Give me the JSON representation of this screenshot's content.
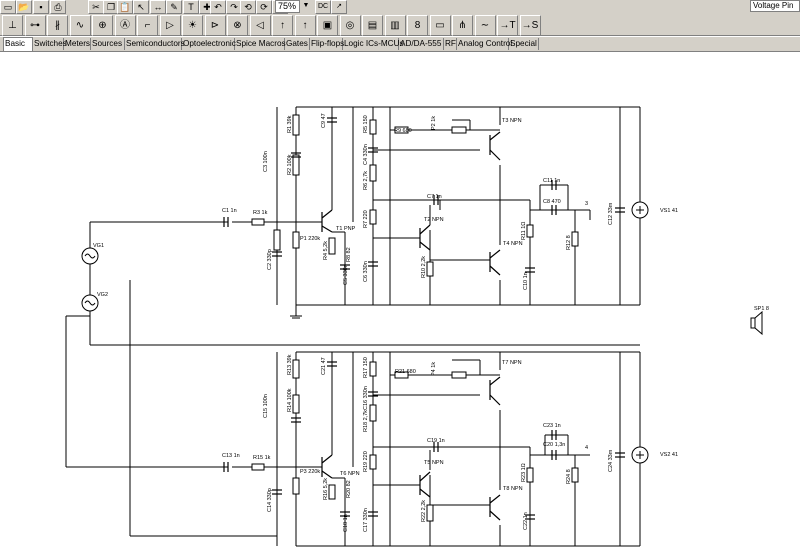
{
  "toolbar": {
    "zoom": "75%",
    "component_select": "Voltage Pin",
    "buttons": [
      {
        "icon": "new-icon",
        "glyph": "▭"
      },
      {
        "icon": "open-icon",
        "glyph": "📂"
      },
      {
        "icon": "save-icon",
        "glyph": "▪"
      },
      {
        "icon": "print-icon",
        "glyph": "⎙"
      },
      {
        "icon": "cut-icon",
        "glyph": "✂"
      },
      {
        "icon": "copy-icon",
        "glyph": "❐"
      },
      {
        "icon": "paste-icon",
        "glyph": "📋"
      },
      {
        "icon": "pointer-icon",
        "glyph": "↖"
      },
      {
        "icon": "wire-icon",
        "glyph": "↔"
      },
      {
        "icon": "pencil-icon",
        "glyph": "✎"
      },
      {
        "icon": "text-icon",
        "glyph": "T"
      },
      {
        "icon": "dimension-icon",
        "glyph": "✚"
      },
      {
        "icon": "undo-icon",
        "glyph": "↶"
      },
      {
        "icon": "redo-icon",
        "glyph": "↷"
      },
      {
        "icon": "rotate-left-icon",
        "glyph": "⟲"
      },
      {
        "icon": "rotate-right-icon",
        "glyph": "⟳"
      },
      {
        "icon": "grid-icon",
        "glyph": "⋮"
      }
    ],
    "right_buttons": [
      {
        "icon": "dc-analysis-icon",
        "glyph": "DC"
      },
      {
        "icon": "probe-icon",
        "glyph": "↗"
      }
    ]
  },
  "parts": [
    {
      "icon": "ground-part-icon",
      "glyph": "⊥"
    },
    {
      "icon": "resistor-part-icon",
      "glyph": "⊶"
    },
    {
      "icon": "capacitor-part-icon",
      "glyph": "∦"
    },
    {
      "icon": "inductor-part-icon",
      "glyph": "∿"
    },
    {
      "icon": "voltage-source-part-icon",
      "glyph": "⊕"
    },
    {
      "icon": "ammeter-part-icon",
      "glyph": "Ⓐ"
    },
    {
      "icon": "switch-part-icon",
      "glyph": "⌐"
    },
    {
      "icon": "diode-part-icon",
      "glyph": "▷"
    },
    {
      "icon": "led-part-icon",
      "glyph": "☀"
    },
    {
      "icon": "transistor-part-icon",
      "glyph": "⊳"
    },
    {
      "icon": "lamp-part-icon",
      "glyph": "⊗"
    },
    {
      "icon": "speaker-part-icon",
      "glyph": "◁"
    },
    {
      "icon": "probe-part-icon",
      "glyph": "↑"
    },
    {
      "icon": "voltmeter-part-icon",
      "glyph": "↑"
    },
    {
      "icon": "oscilloscope-part-icon",
      "glyph": "▣"
    },
    {
      "icon": "signal-analyzer-part-icon",
      "glyph": "◎"
    },
    {
      "icon": "function-generator-part-icon",
      "glyph": "▤"
    },
    {
      "icon": "logic-display-part-icon",
      "glyph": "▥"
    },
    {
      "icon": "seven-segment-part-icon",
      "glyph": "8"
    },
    {
      "icon": "monitor-part-icon",
      "glyph": "▭"
    },
    {
      "icon": "traffic-light-part-icon",
      "glyph": "⋔"
    },
    {
      "icon": "ac-source-part-icon",
      "glyph": "∼"
    },
    {
      "icon": "input-pin-part-icon",
      "glyph": "→T"
    },
    {
      "icon": "output-pin-part-icon",
      "glyph": "→S"
    }
  ],
  "tabs": [
    "Basic",
    "Switches",
    "Meters",
    "Sources",
    "Semiconductors",
    "Optoelectronic",
    "Spice Macros",
    "Gates",
    "Flip-flops",
    "Logic ICs-MCUs",
    "AD/DA-555",
    "RF",
    "Analog Control",
    "Special"
  ],
  "schematic": {
    "channel1": {
      "C1": "C1 1n",
      "R3": "R3 1k",
      "P1": "P1 220k",
      "R4": "R4 5,2k",
      "C2": "C2 330p",
      "C3": "C3 100n",
      "R1": "R1 39k",
      "R2": "R2 100k",
      "C9": "C9 47",
      "C4": "C4 330n",
      "R5": "R5 150",
      "R6": "R6 2,7k",
      "R7": "R7 220",
      "R8": "R8 82",
      "C5": "C5 330n",
      "C6": "C6 330n",
      "R9": "R9 680",
      "P2": "P2 1k",
      "T1": "T1 PNP",
      "T2": "T2 NPN",
      "T3": "T3 NPN",
      "T4": "T4 NPN",
      "R10": "R10 2,2k",
      "C7": "C7 1n",
      "C8": "C8 470",
      "C11": "C11 1n",
      "R11": "R11 1Ω",
      "R12": "R12 8",
      "C10": "C10 1n",
      "C12": "C12 33m",
      "VG1": "VG1",
      "VG2": "VG2",
      "VS1": "VS1 41",
      "node": "3"
    },
    "channel2": {
      "C13": "C13 1n",
      "R15": "R15 1k",
      "P3": "P3 220k",
      "R16": "R16 5,2k",
      "C14": "C14 330p",
      "C15": "C15 100n",
      "R13": "R13 39k",
      "R14": "R14 100k",
      "C21": "C21 47",
      "C16": "C16 330n",
      "R17": "R17 150",
      "R18": "R18 2,7k",
      "R19": "R19 220",
      "R20": "R20 82",
      "C18": "C18 1n",
      "C17": "C17 330n",
      "R21": "R21 680",
      "P4": "P4 1k",
      "T5": "T5 NPN",
      "T6": "T6 NPN",
      "T7": "T7 NPN",
      "T8": "T8 NPN",
      "R22": "R22 2,2k",
      "C19": "C19 1n",
      "C20": "C20 1,3n",
      "C23": "C23 1n",
      "R23": "R23 1Ω",
      "R24": "R24 8",
      "C22": "C22 1n",
      "C24": "C24 33m",
      "VS2": "VS2 41",
      "node": "4"
    },
    "speaker": "SP1 8"
  }
}
